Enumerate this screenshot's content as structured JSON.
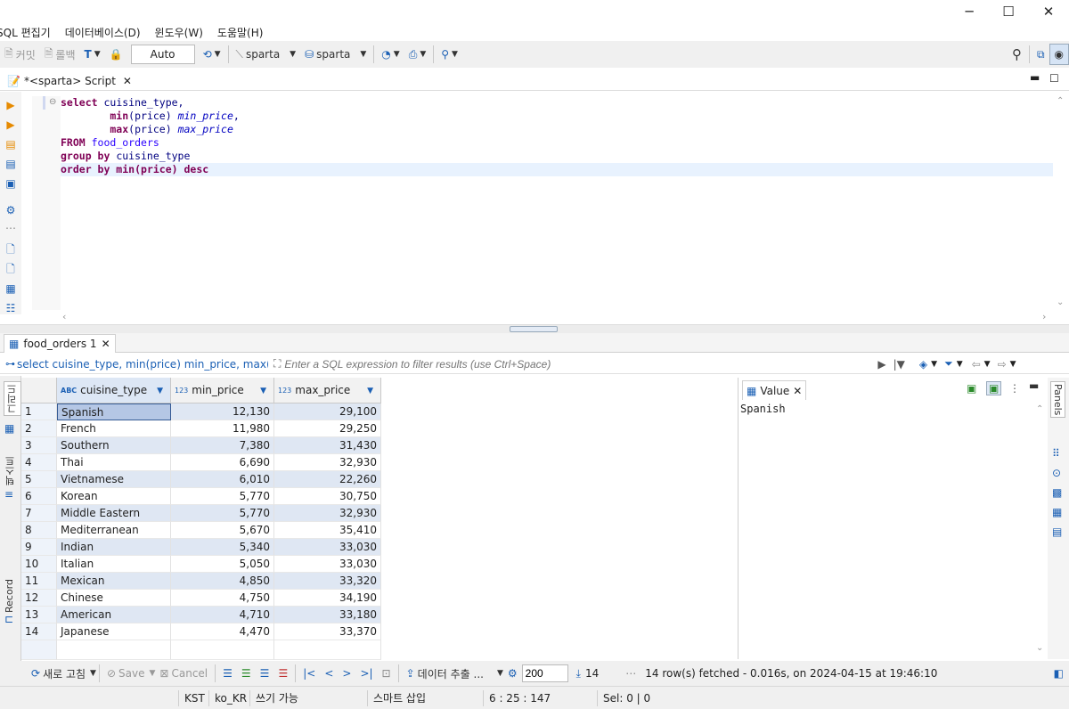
{
  "window": {
    "minimize": "─",
    "maximize": "☐",
    "close": "✕"
  },
  "menu": [
    "SQL 편집기",
    "데이터베이스(D)",
    "윈도우(W)",
    "도움말(H)"
  ],
  "toolbar": {
    "commit": "커밋",
    "rollback": "롤백",
    "transaction_mode": "Auto",
    "datasource": "sparta",
    "schema": "sparta"
  },
  "editor_tab": {
    "title": "*<sparta> Script"
  },
  "sql_lines": [
    [
      {
        "t": "select",
        "c": "kw"
      },
      {
        "t": " cuisine_type,",
        "c": "fn"
      }
    ],
    [
      {
        "t": "        min",
        "c": "kw"
      },
      {
        "t": "(price) ",
        "c": "fn"
      },
      {
        "t": "min_price",
        "c": "al"
      },
      {
        "t": ",",
        "c": "fn"
      }
    ],
    [
      {
        "t": "        max",
        "c": "kw"
      },
      {
        "t": "(price) ",
        "c": "fn"
      },
      {
        "t": "max_price",
        "c": "al"
      }
    ],
    [
      {
        "t": "FROM",
        "c": "kw"
      },
      {
        "t": " food_orders",
        "c": "id"
      }
    ],
    [
      {
        "t": "group by",
        "c": "kw"
      },
      {
        "t": " cuisine_type",
        "c": "fn"
      }
    ],
    [
      {
        "t": "order by min",
        "c": "kw"
      },
      {
        "t": "(price) ",
        "c": "kw"
      },
      {
        "t": "desc",
        "c": "kw"
      }
    ]
  ],
  "result_tab": {
    "title": "food_orders 1"
  },
  "filter": {
    "query_text": "select cuisine_type, min(price) min_price, max(pric",
    "placeholder": "Enter a SQL expression to filter results (use Ctrl+Space)"
  },
  "side_tabs": {
    "grid": "그리드",
    "text": "텍스트",
    "record": "Record"
  },
  "columns": [
    {
      "label": "cuisine_type",
      "type_badge": "ABC"
    },
    {
      "label": "min_price",
      "type_badge": "123"
    },
    {
      "label": "max_price",
      "type_badge": "123"
    }
  ],
  "rows": [
    [
      "1",
      "Spanish",
      "12,130",
      "29,100"
    ],
    [
      "2",
      "French",
      "11,980",
      "29,250"
    ],
    [
      "3",
      "Southern",
      "7,380",
      "31,430"
    ],
    [
      "4",
      "Thai",
      "6,690",
      "32,930"
    ],
    [
      "5",
      "Vietnamese",
      "6,010",
      "22,260"
    ],
    [
      "6",
      "Korean",
      "5,770",
      "30,750"
    ],
    [
      "7",
      "Middle Eastern",
      "5,770",
      "32,930"
    ],
    [
      "8",
      "Mediterranean",
      "5,670",
      "35,410"
    ],
    [
      "9",
      "Indian",
      "5,340",
      "33,030"
    ],
    [
      "10",
      "Italian",
      "5,050",
      "33,030"
    ],
    [
      "11",
      "Mexican",
      "4,850",
      "33,320"
    ],
    [
      "12",
      "Chinese",
      "4,750",
      "34,190"
    ],
    [
      "13",
      "American",
      "4,710",
      "33,180"
    ],
    [
      "14",
      "Japanese",
      "4,470",
      "33,370"
    ]
  ],
  "value_panel": {
    "title": "Value",
    "content": "Spanish"
  },
  "right_panel": {
    "label": "Panels"
  },
  "bottom": {
    "refresh": "새로 고침",
    "save": "Save",
    "cancel": "Cancel",
    "export": "데이터 추출 ...",
    "fetch_size": "200",
    "row_count": "14",
    "fetch_status": "14 row(s) fetched - 0.016s, on 2024-04-15 at 19:46:10"
  },
  "status": {
    "timezone": "KST",
    "locale": "ko_KR",
    "mode": "쓰기 가능",
    "insert": "스마트 삽입",
    "position": "6 : 25 : 147",
    "selection": "Sel: 0 | 0"
  },
  "colors": {
    "keyword": "#7f0055",
    "alt_row": "#dfe7f3",
    "selected_cell": "#b5c7e5",
    "accent": "#1a5fb4"
  }
}
